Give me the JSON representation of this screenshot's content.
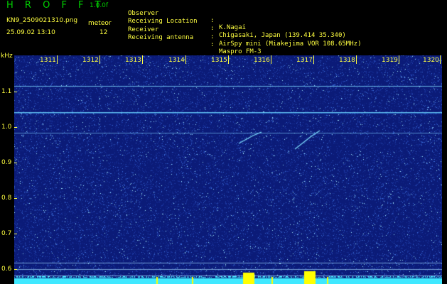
{
  "header": {
    "app_title": "H R O F F T",
    "version": "1.0.0f",
    "filename": "KN9_2509021310.png",
    "datetime": "25.09.02 13:10",
    "meteor_label": "meteor",
    "meteor_count": "12"
  },
  "meta": [
    {
      "label": "Observer",
      "colon": ":",
      "value": "K.Nagai"
    },
    {
      "label": "Receiving Location",
      "colon": ":",
      "value": "Chigasaki, Japan (139.414 35.340)"
    },
    {
      "label": "Receiver",
      "colon": ":",
      "value": "AirSpy mini (Miakejima VOR 108.65MHz)"
    },
    {
      "label": "Receiving antenna",
      "colon": ":",
      "value": "Maspro FM-3"
    }
  ],
  "axis": {
    "unit": "kHz",
    "y_ticks": [
      "1.1",
      "1.0",
      "0.9",
      "0.8",
      "0.7",
      "0.6"
    ],
    "x_ticks": [
      "1311",
      "1312",
      "1313",
      "1314",
      "1315",
      "1316",
      "1317",
      "1318",
      "1319",
      "1320"
    ]
  },
  "colors": {
    "background": "#0a1a70",
    "accent_yellow": "#ffff40",
    "title_green": "#00c800",
    "signal_cyan": "#3fe8ff"
  }
}
